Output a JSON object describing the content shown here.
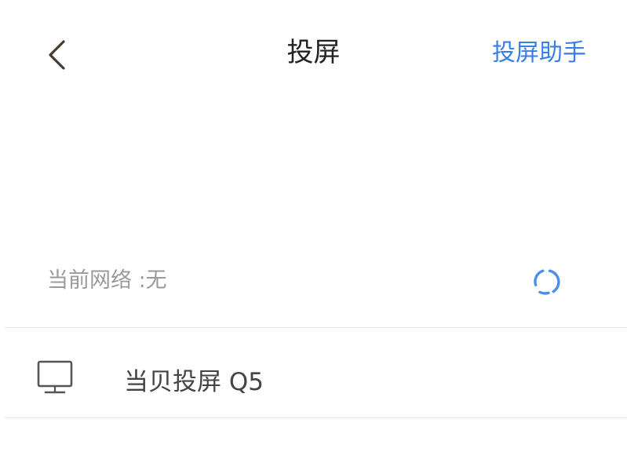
{
  "header": {
    "title": "投屏",
    "action_label": "投屏助手"
  },
  "network": {
    "label": "当前网络 :无"
  },
  "devices": [
    {
      "name": "当贝投屏 Q5"
    }
  ],
  "colors": {
    "accent": "#3a7ee8",
    "title": "#222222",
    "muted": "#9a9a9a",
    "divider": "#e8e8e8"
  }
}
